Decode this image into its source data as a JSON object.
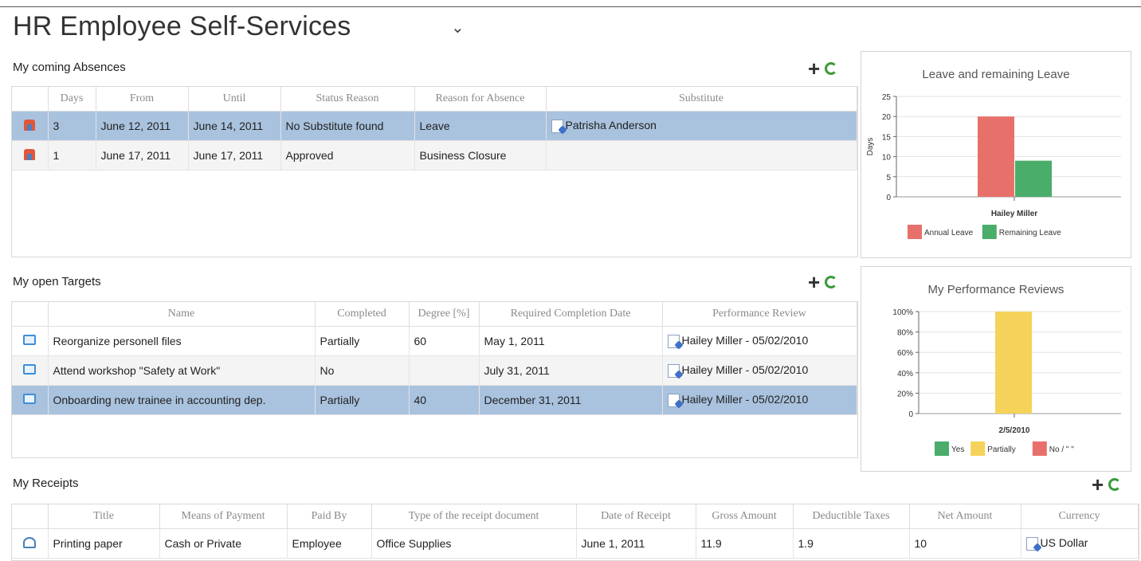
{
  "app": {
    "title": "HR Employee Self-Services"
  },
  "absences": {
    "title": "My coming Absences",
    "columns": [
      "Days",
      "From",
      "Until",
      "Status Reason",
      "Reason for Absence",
      "Substitute"
    ],
    "rows": [
      {
        "days": "3",
        "from": "June 12, 2011",
        "until": "June 14, 2011",
        "status": "No Substitute found",
        "reason": "Leave",
        "substitute": "Patrisha Anderson"
      },
      {
        "days": "1",
        "from": "June 17, 2011",
        "until": "June 17, 2011",
        "status": "Approved",
        "reason": "Business Closure",
        "substitute": ""
      }
    ]
  },
  "targets": {
    "title": "My open Targets",
    "columns": [
      "Name",
      "Completed",
      "Degree [%]",
      "Required Completion Date",
      "Performance Review"
    ],
    "rows": [
      {
        "name": "Reorganize personell files",
        "completed": "Partially",
        "degree": "60",
        "date": "May 1, 2011",
        "review": "Hailey Miller - 05/02/2010"
      },
      {
        "name": "Attend workshop \"Safety at Work\"",
        "completed": "No",
        "degree": "",
        "date": "July 31, 2011",
        "review": "Hailey Miller - 05/02/2010"
      },
      {
        "name": "Onboarding new trainee in accounting dep.",
        "completed": "Partially",
        "degree": "40",
        "date": "December 31, 2011",
        "review": "Hailey Miller - 05/02/2010"
      }
    ]
  },
  "receipts": {
    "title": "My Receipts",
    "columns": [
      "Title",
      "Means of Payment",
      "Paid By",
      "Type of the receipt document",
      "Date of Receipt",
      "Gross Amount",
      "Deductible Taxes",
      "Net Amount",
      "Currency"
    ],
    "rows": [
      {
        "title": "Printing paper",
        "means": "Cash or Private",
        "paid_by": "Employee",
        "type": "Office Supplies",
        "date": "June 1, 2011",
        "gross": "11.9",
        "taxes": "1.9",
        "net": "10",
        "currency": "US Dollar"
      }
    ]
  },
  "colors": {
    "selected_row": "#a9c2de",
    "annual": "#e8706b",
    "remaining": "#4aad6a",
    "yes": "#4aad6a",
    "partially": "#f5d35a",
    "no": "#e8706b"
  },
  "chart_data": [
    {
      "type": "bar",
      "title": "Leave and remaining Leave",
      "categories": [
        "Hailey Miller"
      ],
      "series": [
        {
          "name": "Annual Leave",
          "values": [
            20
          ]
        },
        {
          "name": "Remaining Leave",
          "values": [
            9
          ]
        }
      ],
      "ylabel": "Days",
      "yticks": [
        "0",
        "5",
        "10",
        "15",
        "20",
        "25"
      ],
      "ylim": [
        0,
        25
      ],
      "legend": "bottom"
    },
    {
      "type": "bar",
      "title": "My Performance Reviews",
      "categories": [
        "2/5/2010"
      ],
      "series": [
        {
          "name": "Yes",
          "values": [
            0
          ]
        },
        {
          "name": "Partially",
          "values": [
            100
          ]
        },
        {
          "name": "No / \" \"",
          "values": [
            0
          ]
        }
      ],
      "yticks": [
        "0",
        "20%",
        "40%",
        "60%",
        "80%",
        "100%"
      ],
      "ylim": [
        0,
        100
      ],
      "legend": "bottom"
    }
  ]
}
